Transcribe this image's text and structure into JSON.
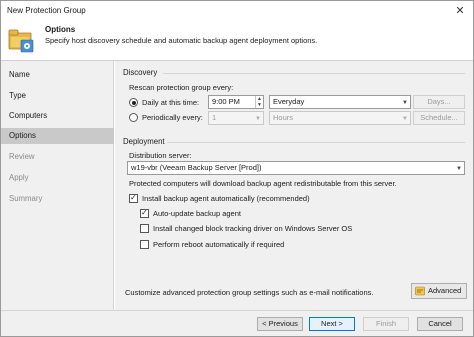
{
  "window": {
    "title": "New Protection Group",
    "close_glyph": "✕"
  },
  "header": {
    "title": "Options",
    "description": "Specify host discovery schedule and automatic backup agent deployment options.",
    "icon": "folder-gear-icon"
  },
  "sidebar": {
    "items": [
      {
        "label": "Name",
        "state": "normal"
      },
      {
        "label": "Type",
        "state": "normal"
      },
      {
        "label": "Computers",
        "state": "normal"
      },
      {
        "label": "Options",
        "state": "active"
      },
      {
        "label": "Review",
        "state": "disabled"
      },
      {
        "label": "Apply",
        "state": "disabled"
      },
      {
        "label": "Summary",
        "state": "disabled"
      }
    ]
  },
  "discovery": {
    "section_label": "Discovery",
    "rescan_label": "Rescan protection group every:",
    "daily_label": "Daily at this time:",
    "daily_selected": true,
    "time_value": "9:00 PM",
    "frequency_value": "Everyday",
    "days_button": "Days...",
    "periodically_label": "Periodically every:",
    "period_value": "1",
    "period_unit": "Hours",
    "schedule_button": "Schedule..."
  },
  "deployment": {
    "section_label": "Deployment",
    "distribution_label": "Distribution server:",
    "distribution_value": "w19-vbr (Veeam Backup Server [Prod])",
    "note": "Protected computers will download backup agent redistributable from this server.",
    "install_agent_label": "Install backup agent automatically (recommended)",
    "install_agent_checked": true,
    "auto_update_label": "Auto-update backup agent",
    "auto_update_checked": true,
    "cbt_label": "Install changed block tracking driver on Windows Server OS",
    "cbt_checked": false,
    "reboot_label": "Perform reboot automatically if required",
    "reboot_checked": false
  },
  "advanced": {
    "text": "Customize advanced protection group settings such as e-mail notifications.",
    "button": "Advanced",
    "icon": "advanced-settings-icon"
  },
  "footer": {
    "previous": "< Previous",
    "next": "Next >",
    "finish": "Finish",
    "cancel": "Cancel"
  },
  "colors": {
    "primary_border": "#0078d7",
    "active_nav": "#c9c9c9"
  }
}
